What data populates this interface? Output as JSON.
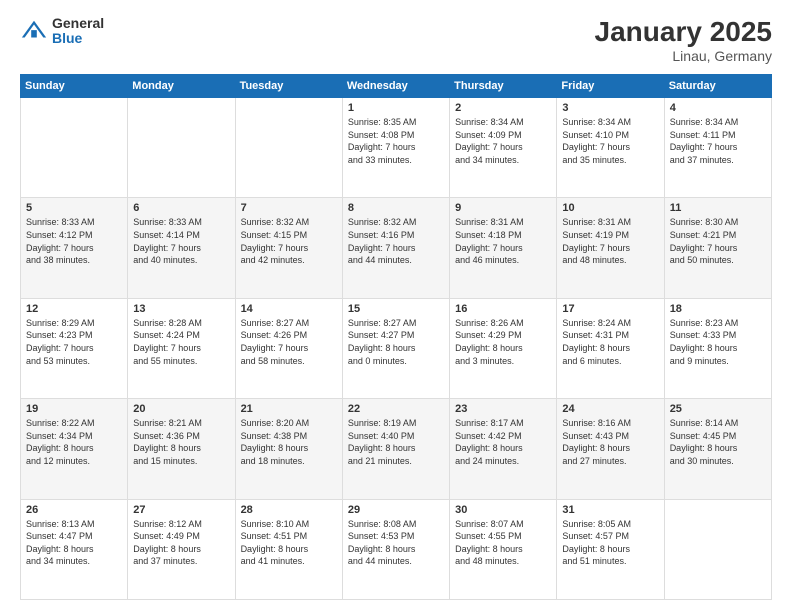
{
  "header": {
    "logo_general": "General",
    "logo_blue": "Blue",
    "title": "January 2025",
    "subtitle": "Linau, Germany"
  },
  "weekdays": [
    "Sunday",
    "Monday",
    "Tuesday",
    "Wednesday",
    "Thursday",
    "Friday",
    "Saturday"
  ],
  "rows": [
    [
      {
        "day": "",
        "info": ""
      },
      {
        "day": "",
        "info": ""
      },
      {
        "day": "",
        "info": ""
      },
      {
        "day": "1",
        "info": "Sunrise: 8:35 AM\nSunset: 4:08 PM\nDaylight: 7 hours\nand 33 minutes."
      },
      {
        "day": "2",
        "info": "Sunrise: 8:34 AM\nSunset: 4:09 PM\nDaylight: 7 hours\nand 34 minutes."
      },
      {
        "day": "3",
        "info": "Sunrise: 8:34 AM\nSunset: 4:10 PM\nDaylight: 7 hours\nand 35 minutes."
      },
      {
        "day": "4",
        "info": "Sunrise: 8:34 AM\nSunset: 4:11 PM\nDaylight: 7 hours\nand 37 minutes."
      }
    ],
    [
      {
        "day": "5",
        "info": "Sunrise: 8:33 AM\nSunset: 4:12 PM\nDaylight: 7 hours\nand 38 minutes."
      },
      {
        "day": "6",
        "info": "Sunrise: 8:33 AM\nSunset: 4:14 PM\nDaylight: 7 hours\nand 40 minutes."
      },
      {
        "day": "7",
        "info": "Sunrise: 8:32 AM\nSunset: 4:15 PM\nDaylight: 7 hours\nand 42 minutes."
      },
      {
        "day": "8",
        "info": "Sunrise: 8:32 AM\nSunset: 4:16 PM\nDaylight: 7 hours\nand 44 minutes."
      },
      {
        "day": "9",
        "info": "Sunrise: 8:31 AM\nSunset: 4:18 PM\nDaylight: 7 hours\nand 46 minutes."
      },
      {
        "day": "10",
        "info": "Sunrise: 8:31 AM\nSunset: 4:19 PM\nDaylight: 7 hours\nand 48 minutes."
      },
      {
        "day": "11",
        "info": "Sunrise: 8:30 AM\nSunset: 4:21 PM\nDaylight: 7 hours\nand 50 minutes."
      }
    ],
    [
      {
        "day": "12",
        "info": "Sunrise: 8:29 AM\nSunset: 4:23 PM\nDaylight: 7 hours\nand 53 minutes."
      },
      {
        "day": "13",
        "info": "Sunrise: 8:28 AM\nSunset: 4:24 PM\nDaylight: 7 hours\nand 55 minutes."
      },
      {
        "day": "14",
        "info": "Sunrise: 8:27 AM\nSunset: 4:26 PM\nDaylight: 7 hours\nand 58 minutes."
      },
      {
        "day": "15",
        "info": "Sunrise: 8:27 AM\nSunset: 4:27 PM\nDaylight: 8 hours\nand 0 minutes."
      },
      {
        "day": "16",
        "info": "Sunrise: 8:26 AM\nSunset: 4:29 PM\nDaylight: 8 hours\nand 3 minutes."
      },
      {
        "day": "17",
        "info": "Sunrise: 8:24 AM\nSunset: 4:31 PM\nDaylight: 8 hours\nand 6 minutes."
      },
      {
        "day": "18",
        "info": "Sunrise: 8:23 AM\nSunset: 4:33 PM\nDaylight: 8 hours\nand 9 minutes."
      }
    ],
    [
      {
        "day": "19",
        "info": "Sunrise: 8:22 AM\nSunset: 4:34 PM\nDaylight: 8 hours\nand 12 minutes."
      },
      {
        "day": "20",
        "info": "Sunrise: 8:21 AM\nSunset: 4:36 PM\nDaylight: 8 hours\nand 15 minutes."
      },
      {
        "day": "21",
        "info": "Sunrise: 8:20 AM\nSunset: 4:38 PM\nDaylight: 8 hours\nand 18 minutes."
      },
      {
        "day": "22",
        "info": "Sunrise: 8:19 AM\nSunset: 4:40 PM\nDaylight: 8 hours\nand 21 minutes."
      },
      {
        "day": "23",
        "info": "Sunrise: 8:17 AM\nSunset: 4:42 PM\nDaylight: 8 hours\nand 24 minutes."
      },
      {
        "day": "24",
        "info": "Sunrise: 8:16 AM\nSunset: 4:43 PM\nDaylight: 8 hours\nand 27 minutes."
      },
      {
        "day": "25",
        "info": "Sunrise: 8:14 AM\nSunset: 4:45 PM\nDaylight: 8 hours\nand 30 minutes."
      }
    ],
    [
      {
        "day": "26",
        "info": "Sunrise: 8:13 AM\nSunset: 4:47 PM\nDaylight: 8 hours\nand 34 minutes."
      },
      {
        "day": "27",
        "info": "Sunrise: 8:12 AM\nSunset: 4:49 PM\nDaylight: 8 hours\nand 37 minutes."
      },
      {
        "day": "28",
        "info": "Sunrise: 8:10 AM\nSunset: 4:51 PM\nDaylight: 8 hours\nand 41 minutes."
      },
      {
        "day": "29",
        "info": "Sunrise: 8:08 AM\nSunset: 4:53 PM\nDaylight: 8 hours\nand 44 minutes."
      },
      {
        "day": "30",
        "info": "Sunrise: 8:07 AM\nSunset: 4:55 PM\nDaylight: 8 hours\nand 48 minutes."
      },
      {
        "day": "31",
        "info": "Sunrise: 8:05 AM\nSunset: 4:57 PM\nDaylight: 8 hours\nand 51 minutes."
      },
      {
        "day": "",
        "info": ""
      }
    ]
  ]
}
